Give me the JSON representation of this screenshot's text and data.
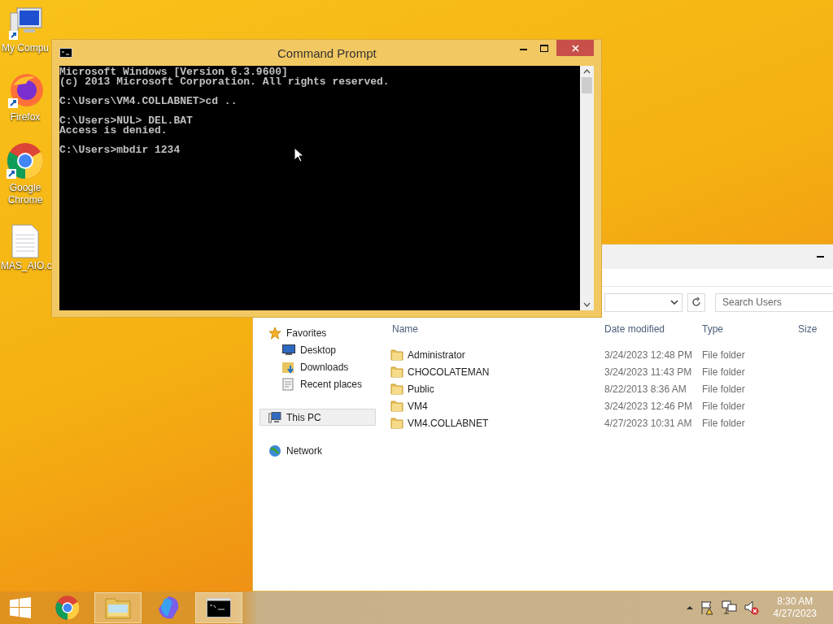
{
  "desktop_icons": [
    {
      "kind": "computer",
      "label": "My Compu"
    },
    {
      "kind": "firefox",
      "label": "Firefox"
    },
    {
      "kind": "chrome",
      "label": "Google Chrome"
    },
    {
      "kind": "document",
      "label": "MAS_AIO.c"
    }
  ],
  "explorer": {
    "search": {
      "placeholder": "Search Users"
    },
    "nav": [
      {
        "kind": "star",
        "label": "Favorites",
        "selected": false,
        "children": [
          {
            "kind": "desktop",
            "label": "Desktop",
            "selected": false
          },
          {
            "kind": "downloads",
            "label": "Downloads",
            "selected": false
          },
          {
            "kind": "recent",
            "label": "Recent places",
            "selected": false
          }
        ]
      },
      {
        "kind": "pc",
        "label": "This PC",
        "selected": true
      },
      {
        "kind": "network",
        "label": "Network",
        "selected": false
      }
    ],
    "columns": [
      "Name",
      "Date modified",
      "Type",
      "Size"
    ],
    "rows": [
      {
        "name": "Administrator",
        "date": "3/24/2023 12:48 PM",
        "type": "File folder"
      },
      {
        "name": "CHOCOLATEMAN",
        "date": "3/24/2023 11:43 PM",
        "type": "File folder"
      },
      {
        "name": "Public",
        "date": "8/22/2013 8:36 AM",
        "type": "File folder"
      },
      {
        "name": "VM4",
        "date": "3/24/2023 12:46 PM",
        "type": "File folder"
      },
      {
        "name": "VM4.COLLABNET",
        "date": "4/27/2023 10:31 AM",
        "type": "File folder"
      }
    ]
  },
  "cmd": {
    "title": "Command Prompt",
    "blocks": [
      [
        "Microsoft Windows [Version 6.3.9600]",
        "(c) 2013 Microsoft Corporation. All rights reserved."
      ],
      [
        "C:\\Users\\VM4.COLLABNET>cd .."
      ],
      [
        "C:\\Users>NUL> DEL.BAT",
        "Access is denied."
      ],
      [
        "C:\\Users>mbdir 1234"
      ]
    ]
  },
  "taskbar": {
    "apps": [
      {
        "kind": "chrome",
        "selected": false,
        "running": false
      },
      {
        "kind": "explorer",
        "selected": false,
        "running": true
      },
      {
        "kind": "copilot",
        "selected": false,
        "running": false
      },
      {
        "kind": "cmd",
        "selected": true,
        "running": true
      }
    ],
    "time": "8:30 AM",
    "date": "4/27/2023"
  }
}
